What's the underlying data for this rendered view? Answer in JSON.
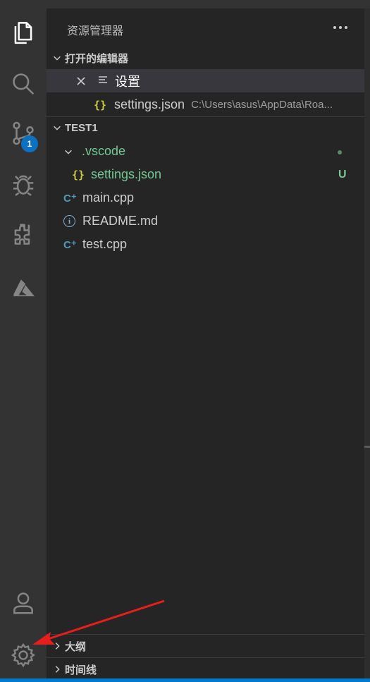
{
  "activity": {
    "items": [
      "explorer-icon",
      "search-icon",
      "source-control-icon",
      "debug-icon",
      "extensions-icon",
      "azure-icon"
    ],
    "scm_badge": "1",
    "bottom": [
      "account-icon",
      "settings-gear-icon"
    ]
  },
  "explorer": {
    "title": "资源管理器",
    "open_editors": {
      "label": "打开的编辑器",
      "items": [
        {
          "name": "设置",
          "icon": "settings-editor-icon"
        },
        {
          "name": "settings.json",
          "path": "C:\\Users\\asus\\AppData\\Roa...",
          "icon": "json-icon"
        }
      ]
    },
    "workspace": {
      "label": "TEST1",
      "folder": {
        "name": ".vscode",
        "status_dot": "●"
      },
      "items": [
        {
          "name": "settings.json",
          "status": "U",
          "icon": "{}"
        },
        {
          "name": "main.cpp",
          "icon": "C⁺"
        },
        {
          "name": "README.md",
          "icon": "i"
        },
        {
          "name": "test.cpp",
          "icon": "C⁺"
        }
      ]
    },
    "outline_label": "大纲",
    "timeline_label": "时间线"
  },
  "colors": {
    "git_untracked": "#73c991",
    "badge": "#0e70c0",
    "json_icon": "#cbcb41",
    "cpp_icon": "#519aba",
    "arrow": "#e81e1e",
    "status_bar": "#007acc"
  }
}
